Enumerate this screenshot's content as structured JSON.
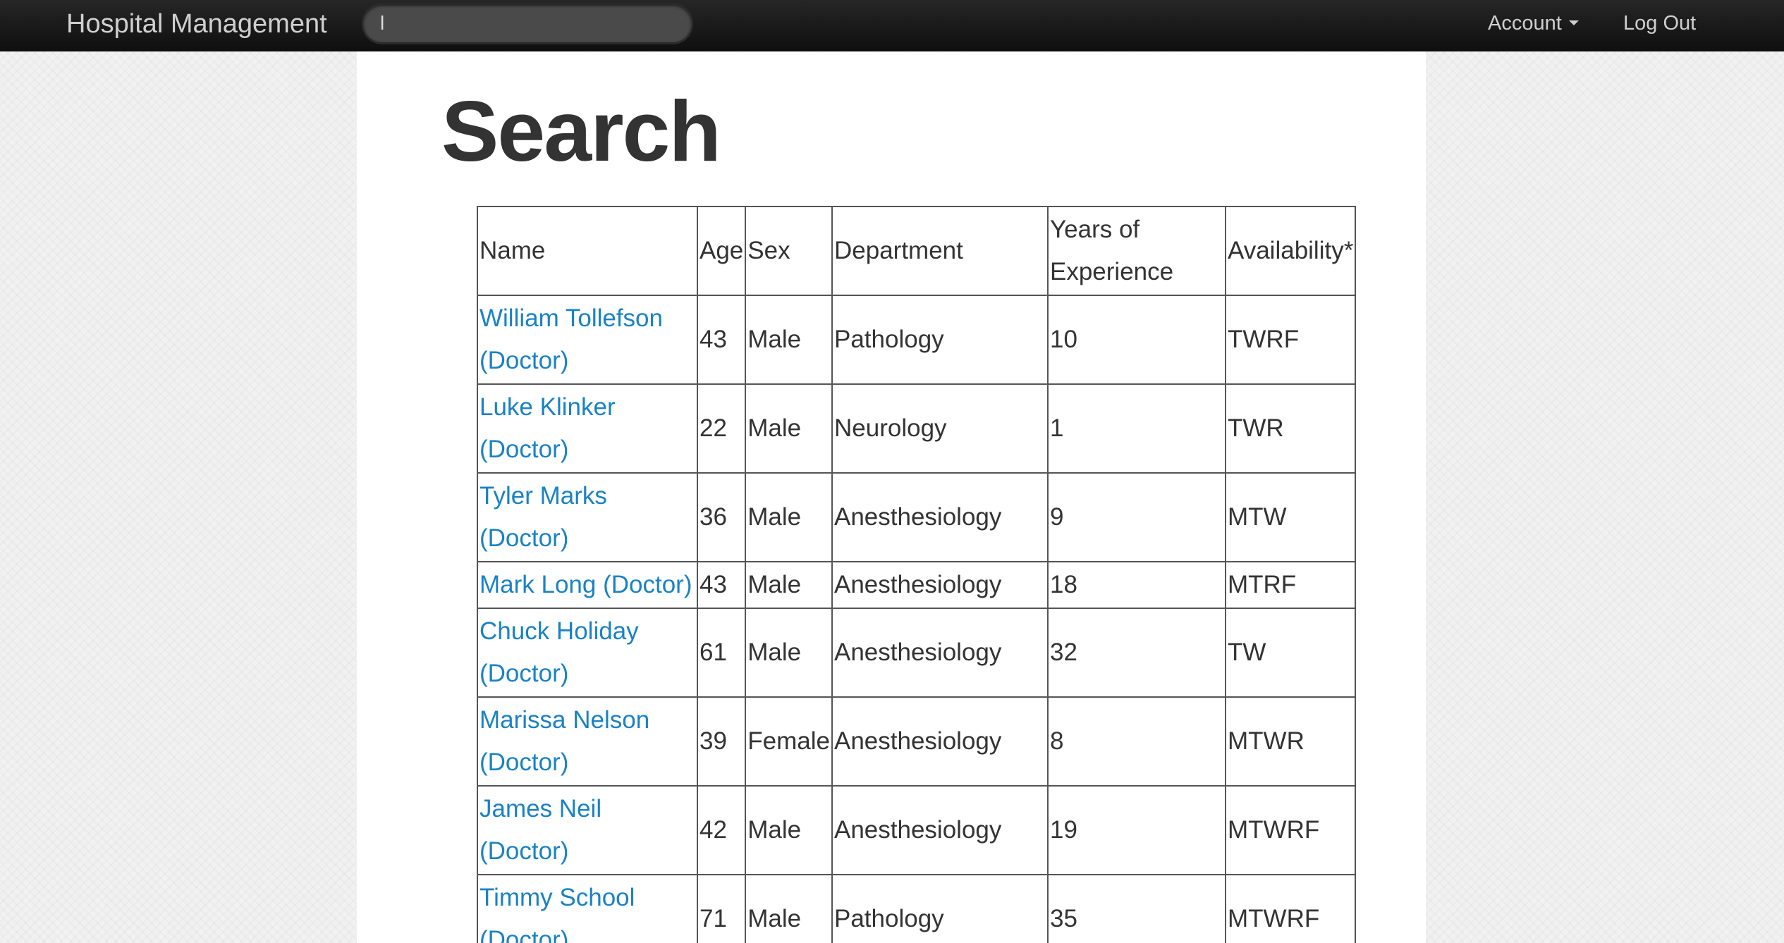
{
  "navbar": {
    "brand": "Hospital Management",
    "search_value": "l",
    "account_label": "Account",
    "logout_label": "Log Out"
  },
  "page": {
    "title": "Search"
  },
  "table": {
    "headers": [
      "Name",
      "Age",
      "Sex",
      "Department",
      "Years of Experience",
      "Availability*"
    ],
    "rows": [
      {
        "name": "William Tollefson (Doctor)",
        "age": "43",
        "sex": "Male",
        "department": "Pathology",
        "experience": "10",
        "availability": "TWRF"
      },
      {
        "name": "Luke Klinker (Doctor)",
        "age": "22",
        "sex": "Male",
        "department": "Neurology",
        "experience": "1",
        "availability": "TWR"
      },
      {
        "name": "Tyler Marks (Doctor)",
        "age": "36",
        "sex": "Male",
        "department": "Anesthesiology",
        "experience": "9",
        "availability": "MTW"
      },
      {
        "name": "Mark Long (Doctor)",
        "age": "43",
        "sex": "Male",
        "department": "Anesthesiology",
        "experience": "18",
        "availability": "MTRF"
      },
      {
        "name": "Chuck Holiday (Doctor)",
        "age": "61",
        "sex": "Male",
        "department": "Anesthesiology",
        "experience": "32",
        "availability": "TW"
      },
      {
        "name": "Marissa Nelson (Doctor)",
        "age": "39",
        "sex": "Female",
        "department": "Anesthesiology",
        "experience": "8",
        "availability": "MTWR"
      },
      {
        "name": "James Neil (Doctor)",
        "age": "42",
        "sex": "Male",
        "department": "Anesthesiology",
        "experience": "19",
        "availability": "MTWRF"
      },
      {
        "name": "Timmy School (Doctor)",
        "age": "71",
        "sex": "Male",
        "department": "Pathology",
        "experience": "35",
        "availability": "MTWRF"
      }
    ]
  },
  "colors": {
    "navbar": "#1a1a1a",
    "link": "#1a82c4",
    "text": "#333333"
  }
}
